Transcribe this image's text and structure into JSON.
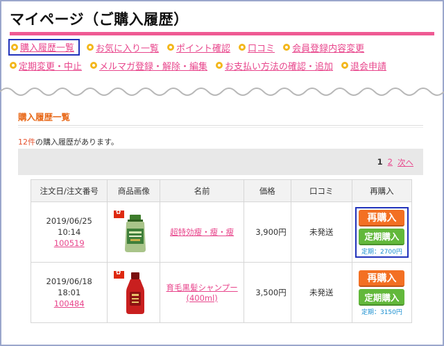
{
  "page": {
    "title": "マイページ（ご購入履歴）"
  },
  "nav": {
    "row1": [
      {
        "label": "購入履歴一覧",
        "active": true
      },
      {
        "label": "お気に入り一覧"
      },
      {
        "label": "ポイント確認"
      },
      {
        "label": "口コミ"
      },
      {
        "label": "会員登録内容変更"
      }
    ],
    "row2": [
      {
        "label": "定期変更・中止"
      },
      {
        "label": "メルマガ登録・解除・編集"
      },
      {
        "label": "お支払い方法の確認・追加"
      },
      {
        "label": "退会申請"
      }
    ]
  },
  "section": {
    "title": "購入履歴一覧",
    "count": "12件",
    "count_suffix": "の購入履歴があります。"
  },
  "pager": {
    "current": "1",
    "page2": "2",
    "next": "次へ"
  },
  "table": {
    "headers": [
      "注文日/注文番号",
      "商品画像",
      "名前",
      "価格",
      "口コミ",
      "再購入"
    ],
    "rows": [
      {
        "date": "2019/06/25",
        "time": "10:14",
        "order_no": "100519",
        "name": "超特効瘦・瘦・瘦",
        "price": "3,900円",
        "review": "未発送",
        "rebuy_label": "再購入",
        "teiki_label": "定期購入",
        "teiki_price": "定期：2700円",
        "image": "green-bottle-icon"
      },
      {
        "date": "2019/06/18",
        "time": "18:01",
        "order_no": "100484",
        "name": "育毛黒髪シャンプー(400ml)",
        "price": "3,500円",
        "review": "未発送",
        "rebuy_label": "再購入",
        "teiki_label": "定期購入",
        "teiki_price": "定期：3150円",
        "image": "red-bottle-icon"
      }
    ]
  },
  "colors": {
    "accent_pink": "#ef5a93",
    "link_pink": "#e8468c",
    "orange": "#f37023",
    "green": "#62b83b",
    "highlight_blue": "#2233bb"
  }
}
